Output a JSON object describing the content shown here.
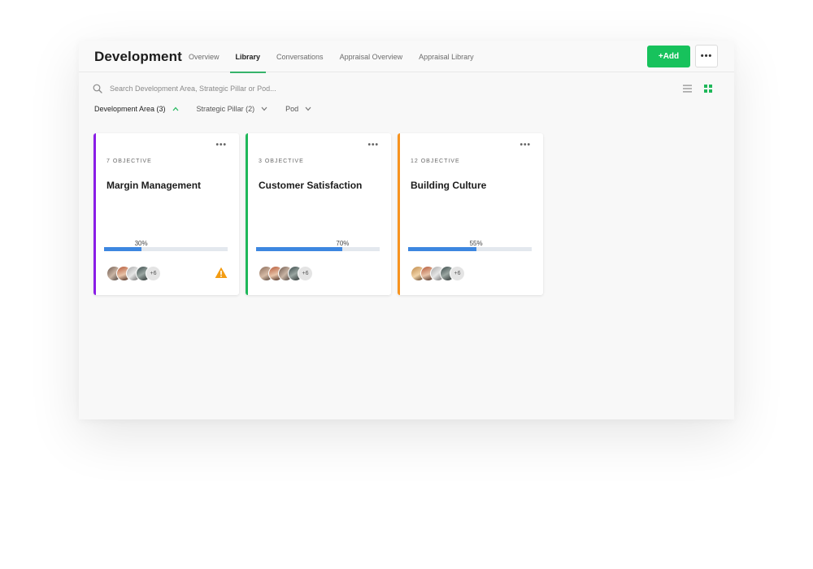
{
  "header": {
    "title": "Development",
    "tabs": [
      {
        "label": "Overview",
        "active": false
      },
      {
        "label": "Library",
        "active": true
      },
      {
        "label": "Conversations",
        "active": false
      },
      {
        "label": "Appraisal Overview",
        "active": false
      },
      {
        "label": "Appraisal Library",
        "active": false
      }
    ],
    "add_label": "+Add",
    "more_label": "•••"
  },
  "search": {
    "placeholder": "Search Development Area, Strategic Pillar or Pod...",
    "icon": "search-icon"
  },
  "view": {
    "list_icon": "list-icon",
    "grid_icon": "grid-icon",
    "selected": "grid"
  },
  "filters": [
    {
      "label": "Development Area (3)",
      "expanded": true
    },
    {
      "label": "Strategic Pillar (2)",
      "expanded": false
    },
    {
      "label": "Pod",
      "expanded": false
    }
  ],
  "colors": {
    "accent_green": "#17c25c",
    "progress_blue": "#3d87e0",
    "warning": "#f39c12"
  },
  "cards": [
    {
      "count": "7 OBJECTIVE",
      "title": "Margin Management",
      "progress": 30,
      "progress_label": "30%",
      "accent": "#8a1de6",
      "more_label": "+6",
      "warning": true,
      "menu": "•••"
    },
    {
      "count": "3 OBJECTIVE",
      "title": "Customer Satisfaction",
      "progress": 70,
      "progress_label": "70%",
      "accent": "#1fb85a",
      "more_label": "+6",
      "warning": false,
      "menu": "•••"
    },
    {
      "count": "12 OBJECTIVE",
      "title": "Building Culture",
      "progress": 55,
      "progress_label": "55%",
      "accent": "#f7931e",
      "more_label": "+6",
      "warning": false,
      "menu": "•••"
    }
  ]
}
